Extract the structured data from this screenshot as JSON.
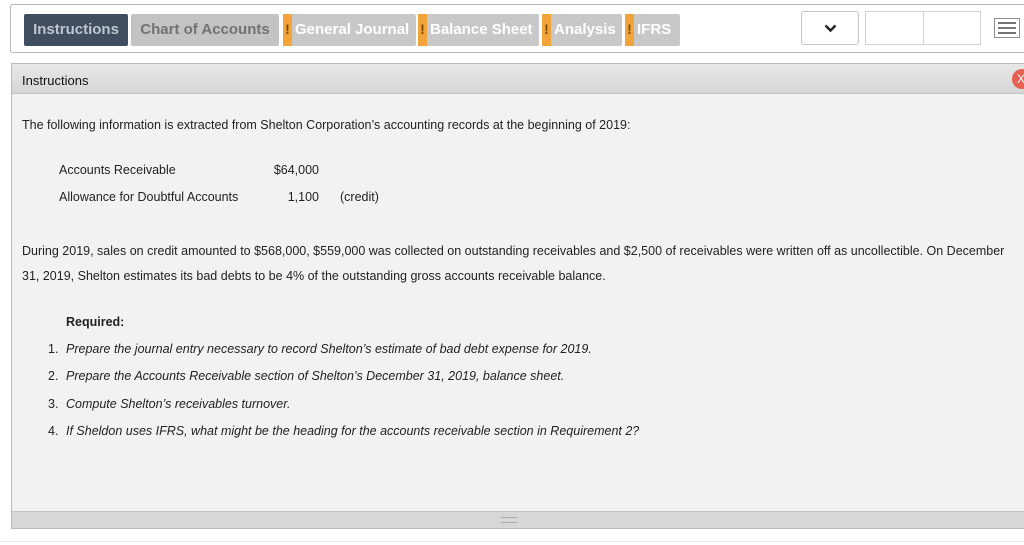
{
  "tabs": [
    {
      "label": "Instructions",
      "state": "active"
    },
    {
      "label": "Chart of Accounts",
      "state": "normal"
    },
    {
      "label": "General Journal",
      "state": "warning",
      "flag": "!"
    },
    {
      "label": "Balance Sheet",
      "state": "warning",
      "flag": "!"
    },
    {
      "label": "Analysis",
      "state": "warning",
      "flag": "!"
    },
    {
      "label": "IFRS",
      "state": "warning",
      "flag": "!"
    }
  ],
  "panel": {
    "title": "Instructions",
    "close_glyph": "X"
  },
  "intro": "The following information is extracted from Shelton Corporation’s accounting records at the beginning of 2019:",
  "accounts": [
    {
      "label": "Accounts Receivable",
      "amount": "$64,000",
      "note": ""
    },
    {
      "label": "Allowance for Doubtful Accounts",
      "amount": "1,100",
      "note": "(credit)"
    }
  ],
  "paragraph": "During 2019, sales on credit amounted to $568,000, $559,000 was collected on outstanding receivables and $2,500 of receivables were written off as uncollectible. On December 31, 2019, Shelton estimates its bad debts to be 4% of the outstanding gross accounts receivable balance.",
  "required": {
    "title": "Required:",
    "items": [
      {
        "num": "1.",
        "text": "Prepare the journal entry necessary to record Shelton’s estimate of bad debt expense for 2019."
      },
      {
        "num": "2.",
        "text": "Prepare the Accounts Receivable section of Shelton’s December 31, 2019, balance sheet."
      },
      {
        "num": "3.",
        "text": "Compute Shelton’s receivables turnover."
      },
      {
        "num": "4.",
        "text": "If Sheldon uses IFRS, what might be the heading for the accounts receivable section in Requirement 2?"
      }
    ]
  },
  "icons": {
    "dropdown": "chevron-down-icon",
    "menu": "hamburger-menu-icon",
    "close": "close-icon",
    "grip": "resize-grip-icon"
  },
  "colors": {
    "active_tab": "#3f4f5f",
    "warning_flag": "#f2a33a",
    "close_button": "#e76152"
  }
}
